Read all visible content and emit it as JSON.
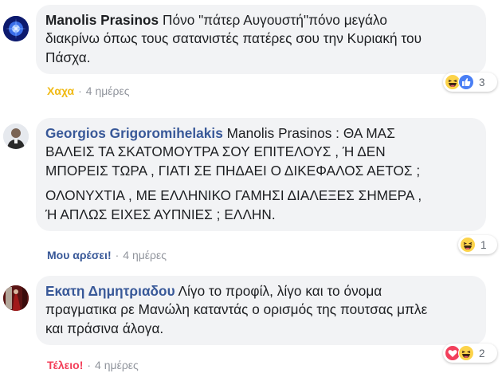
{
  "comments": [
    {
      "author": "Manolis Prasinos",
      "lines": [
        "Πόνο \"πάτερ Αυγουστή\"πόνο μεγάλο",
        "διακρίνω όπως τους σατανιστές πατέρες σου την Κυριακή του",
        "Πάσχα."
      ],
      "action_label": "Χαχα",
      "action_color": "#f0ba15",
      "time": "4 ημέρες",
      "reactions": [
        "haha",
        "like"
      ],
      "reaction_count": "3"
    },
    {
      "author": "Georgios Grigoromihelakis",
      "lines": [
        "Manolis Prasinos : ΘΑ ΜΑΣ",
        "ΒΑΛΕΙΣ ΤΑ ΣΚΑΤΟΜΟΥΤΡΑ ΣΟΥ ΕΠΙΤΕΛΟΥΣ , Ή ΔΕΝ",
        "ΜΠΟΡΕΙΣ ΤΩΡΑ , ΓΙΑΤΙ ΣΕ ΠΗΔΑΕΙ Ο ΔΙΚΕΦΑΛΟΣ ΑΕΤΟΣ ;"
      ],
      "lines2": [
        "ΟΛΟΝΥΧΤΙΑ , ΜΕ ΕΛΛΗΝΙΚΟ ΓΑΜΗΣΙ ΔΙΑΛΕΞΕΣ ΣΗΜΕΡΑ ,",
        "Ή ΑΠΛΩΣ ΕΙΧΕΣ ΑΥΠΝΙΕΣ ; ΕΛΛΗΝ."
      ],
      "action_label": "Μου αρέσει!",
      "action_color": "#385898",
      "time": "4 ημέρες",
      "reactions": [
        "haha"
      ],
      "reaction_count": "1"
    },
    {
      "author": "Εκατη Δημητριαδου",
      "lines": [
        "Λίγο το προφίλ, λίγο και το όνομα",
        "πραγματικα ρε Μανώλη καταντάς ο ορισμός της πουτσας μπλε",
        "και πράσινα άλογα."
      ],
      "action_label": "Τέλειο!",
      "action_color": "#f33e58",
      "time": "4 ημέρες",
      "reactions": [
        "love",
        "haha"
      ],
      "reaction_count": "2"
    }
  ],
  "separator": "·",
  "colors": {
    "bubble": "#f2f3f5",
    "link": "#385898",
    "meta": "#90949c"
  }
}
